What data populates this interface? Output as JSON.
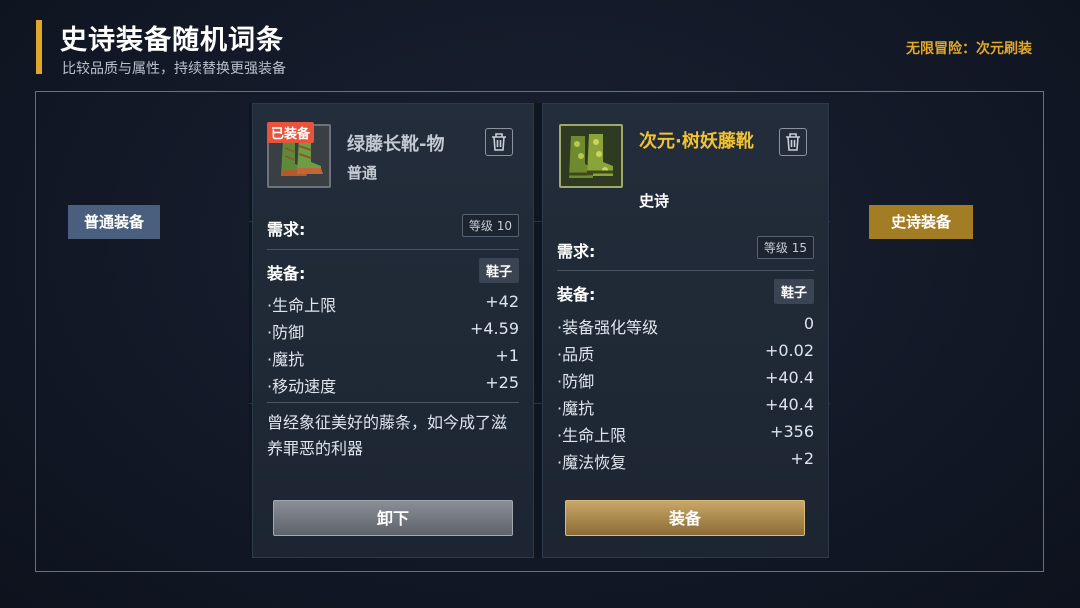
{
  "header": {
    "title": "史诗装备随机词条",
    "subtitle": "比较品质与属性，持续替换更强装备",
    "corner_tag": "无限冒险：次元刷装"
  },
  "labels": {
    "left": "普通装备",
    "right": "史诗装备"
  },
  "colors": {
    "accent_gold": "#e0a72b",
    "normal_label_bg": "#4a5f7d",
    "epic_label_bg": "#a37d24",
    "epic_name": "#f1c232",
    "equipped_badge": "#e8543b"
  },
  "left_card": {
    "badge": "已装备",
    "icon": "green-boots-icon",
    "name": "绿藤长靴-物",
    "quality": "普通",
    "req_label": "需求:",
    "req_level": "等级 10",
    "equip_label": "装备:",
    "slot": "鞋子",
    "stats": [
      {
        "name": "·生命上限",
        "value": "+42"
      },
      {
        "name": "·防御",
        "value": "+4.59"
      },
      {
        "name": "·魔抗",
        "value": "+1"
      },
      {
        "name": "·移动速度",
        "value": "+25"
      }
    ],
    "description": "曾经象征美好的藤条，如今成了滋养罪恶的利器",
    "button": "卸下"
  },
  "right_card": {
    "icon": "vine-boots-icon",
    "name": "次元·树妖藤靴",
    "quality": "史诗",
    "req_label": "需求:",
    "req_level": "等级 15",
    "equip_label": "装备:",
    "slot": "鞋子",
    "stats": [
      {
        "name": "·装备强化等级",
        "value": "0"
      },
      {
        "name": "·品质",
        "value": "+0.02"
      },
      {
        "name": "·防御",
        "value": "+40.4"
      },
      {
        "name": "·魔抗",
        "value": "+40.4"
      },
      {
        "name": "·生命上限",
        "value": "+356"
      },
      {
        "name": "·魔法恢复",
        "value": "+2"
      }
    ],
    "button": "装备"
  }
}
